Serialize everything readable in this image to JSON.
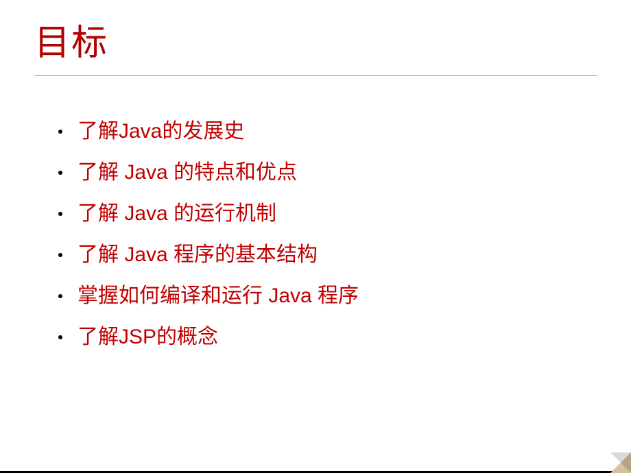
{
  "title": "目标",
  "bullets": [
    "了解Java的发展史",
    "了解 Java 的特点和优点",
    "了解 Java 的运行机制",
    "了解 Java 程序的基本结构",
    "掌握如何编译和运行 Java 程序",
    "了解JSP的概念"
  ]
}
